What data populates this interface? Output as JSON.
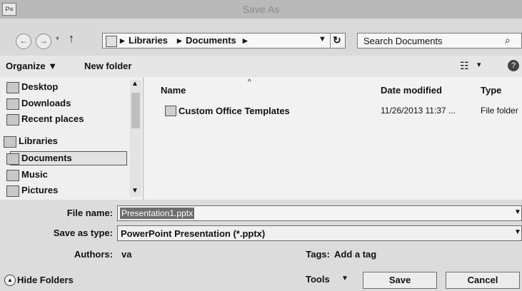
{
  "window": {
    "title": "Save As",
    "app_icon": "P≡"
  },
  "address": {
    "crumbs": [
      "Libraries",
      "Documents"
    ],
    "search_placeholder": "Search Documents"
  },
  "toolbar": {
    "organize": "Organize ▼",
    "new_folder": "New folder"
  },
  "nav": {
    "items": [
      {
        "label": "Desktop",
        "icon": "desktop-icon"
      },
      {
        "label": "Downloads",
        "icon": "downloads-icon"
      },
      {
        "label": "Recent places",
        "icon": "recent-places-icon"
      },
      {
        "label": "Libraries",
        "icon": "libraries-icon"
      },
      {
        "label": "Documents",
        "icon": "documents-icon"
      },
      {
        "label": "Music",
        "icon": "music-icon"
      },
      {
        "label": "Pictures",
        "icon": "pictures-icon"
      }
    ]
  },
  "filelist": {
    "columns": [
      "Name",
      "Date modified",
      "Type"
    ],
    "rows": [
      {
        "name": "Custom Office Templates",
        "date": "11/26/2013 11:37 ...",
        "type": "File folder"
      }
    ]
  },
  "form": {
    "file_name_label": "File name:",
    "file_name_value": "Presentation1.pptx",
    "save_as_type_label": "Save as type:",
    "save_as_type_value": "PowerPoint Presentation (*.pptx)",
    "authors_label": "Authors:",
    "authors_value": "va",
    "tags_label": "Tags:",
    "tags_value": "Add a tag"
  },
  "footer": {
    "hide_folders": "Hide Folders",
    "tools": "Tools",
    "save": "Save",
    "cancel": "Cancel"
  }
}
